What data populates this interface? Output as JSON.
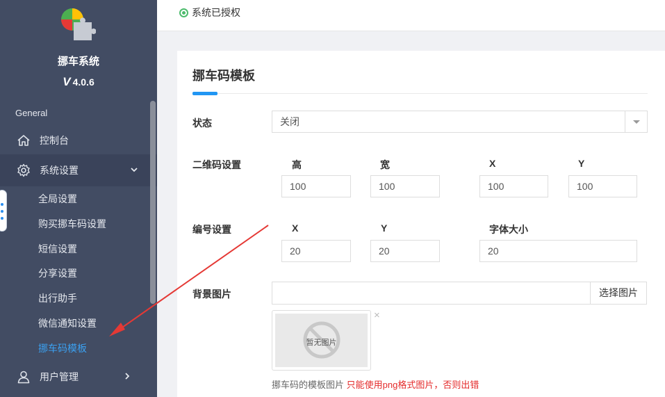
{
  "app": {
    "name": "挪车系统",
    "version": "4.0.6",
    "version_prefix": "V"
  },
  "sidebar": {
    "section": "General",
    "items": [
      {
        "label": "控制台",
        "icon": "home-icon"
      },
      {
        "label": "系统设置",
        "icon": "gear-icon",
        "expanded": true
      },
      {
        "label": "用户管理",
        "icon": "user-icon"
      }
    ],
    "sub_items": [
      "全局设置",
      "购买挪车码设置",
      "短信设置",
      "分享设置",
      "出行助手",
      "微信通知设置",
      "挪车码模板"
    ],
    "current_sub": "挪车码模板"
  },
  "topbar": {
    "auth_status": "系统已授权"
  },
  "form": {
    "title": "挪车码模板",
    "status": {
      "label": "状态",
      "value": "关闭"
    },
    "qr": {
      "label": "二维码设置",
      "fields": [
        {
          "label": "高",
          "value": "100"
        },
        {
          "label": "宽",
          "value": "100"
        },
        {
          "label": "X",
          "value": "100"
        },
        {
          "label": "Y",
          "value": "100"
        }
      ]
    },
    "number": {
      "label": "编号设置",
      "fields": [
        {
          "label": "X",
          "value": "20"
        },
        {
          "label": "Y",
          "value": "20"
        },
        {
          "label": "字体大小",
          "value": "20"
        }
      ]
    },
    "bg": {
      "label": "背景图片",
      "button": "选择图片",
      "placeholder_text": "暂无图片",
      "close": "×",
      "hint": "挪车码的模板图片",
      "warning": "只能使用png格式图片，否则出错"
    }
  },
  "colors": {
    "sidebar_bg": "#424c63",
    "accent": "#2196f3",
    "current": "#3ba0f0",
    "warning": "#e42b2b",
    "auth_dot": "#4cbb6c",
    "annotation_arrow": "#e53935"
  }
}
